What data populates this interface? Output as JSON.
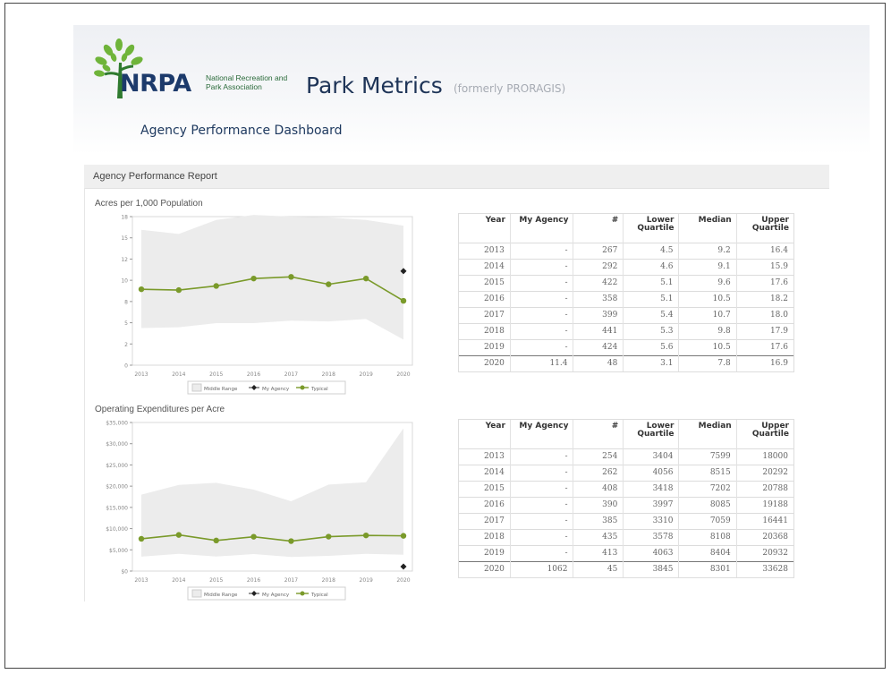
{
  "header": {
    "logo_text": "NRPA",
    "logo_sub": "National Recreation and Park Association",
    "app_title": "Park Metrics",
    "app_subtitle": "(formerly PRORAGIS)",
    "dashboard_title": "Agency Performance Dashboard"
  },
  "report": {
    "title": "Agency Performance Report"
  },
  "legend": {
    "middle_range": "Middle Range",
    "my_agency": "My Agency",
    "typical": "Typical"
  },
  "table_headers": [
    "Year",
    "My Agency",
    "#",
    "Lower Quartile",
    "Median",
    "Upper Quartile"
  ],
  "colors": {
    "series_green": "#7a9a2a",
    "band_gray": "#ececec",
    "agency_marker": "#222222"
  },
  "charts": [
    {
      "title": "Acres per 1,000 Population",
      "chart_data": {
        "type": "line",
        "x": [
          "2013",
          "2014",
          "2015",
          "2016",
          "2017",
          "2018",
          "2019",
          "2020"
        ],
        "ylim": [
          0,
          18
        ],
        "y_ticks": [
          "0",
          "2",
          "5",
          "8",
          "10",
          "12",
          "15",
          "18"
        ],
        "series": [
          {
            "name": "Typical",
            "values": [
              9.2,
              9.1,
              9.6,
              10.5,
              10.7,
              9.8,
              10.5,
              7.8
            ]
          },
          {
            "name": "My Agency",
            "values": [
              null,
              null,
              null,
              null,
              null,
              null,
              null,
              11.4
            ]
          }
        ],
        "band": {
          "name": "Middle Range",
          "lower": [
            4.5,
            4.6,
            5.1,
            5.1,
            5.4,
            5.3,
            5.6,
            3.1
          ],
          "upper": [
            16.4,
            15.9,
            17.6,
            18.2,
            18.0,
            17.9,
            17.6,
            16.9
          ]
        }
      },
      "table": [
        [
          "2013",
          "-",
          "267",
          "4.5",
          "9.2",
          "16.4"
        ],
        [
          "2014",
          "-",
          "292",
          "4.6",
          "9.1",
          "15.9"
        ],
        [
          "2015",
          "-",
          "422",
          "5.1",
          "9.6",
          "17.6"
        ],
        [
          "2016",
          "-",
          "358",
          "5.1",
          "10.5",
          "18.2"
        ],
        [
          "2017",
          "-",
          "399",
          "5.4",
          "10.7",
          "18.0"
        ],
        [
          "2018",
          "-",
          "441",
          "5.3",
          "9.8",
          "17.9"
        ],
        [
          "2019",
          "-",
          "424",
          "5.6",
          "10.5",
          "17.6"
        ],
        [
          "2020",
          "11.4",
          "48",
          "3.1",
          "7.8",
          "16.9"
        ]
      ]
    },
    {
      "title": "Operating Expenditures per Acre",
      "chart_data": {
        "type": "line",
        "x": [
          "2013",
          "2014",
          "2015",
          "2016",
          "2017",
          "2018",
          "2019",
          "2020"
        ],
        "ylim": [
          0,
          35000
        ],
        "y_ticks": [
          "$0",
          "$5,000",
          "$10,000",
          "$15,000",
          "$20,000",
          "$25,000",
          "$30,000",
          "$35,000"
        ],
        "series": [
          {
            "name": "Typical",
            "values": [
              7599,
              8515,
              7202,
              8085,
              7059,
              8108,
              8404,
              8301
            ]
          },
          {
            "name": "My Agency",
            "values": [
              null,
              null,
              null,
              null,
              null,
              null,
              null,
              1062
            ]
          }
        ],
        "band": {
          "name": "Middle Range",
          "lower": [
            3404,
            4056,
            3418,
            3997,
            3310,
            3578,
            4063,
            3845
          ],
          "upper": [
            18000,
            20292,
            20788,
            19188,
            16441,
            20368,
            20932,
            33628
          ]
        }
      },
      "table": [
        [
          "2013",
          "-",
          "254",
          "3404",
          "7599",
          "18000"
        ],
        [
          "2014",
          "-",
          "262",
          "4056",
          "8515",
          "20292"
        ],
        [
          "2015",
          "-",
          "408",
          "3418",
          "7202",
          "20788"
        ],
        [
          "2016",
          "-",
          "390",
          "3997",
          "8085",
          "19188"
        ],
        [
          "2017",
          "-",
          "385",
          "3310",
          "7059",
          "16441"
        ],
        [
          "2018",
          "-",
          "435",
          "3578",
          "8108",
          "20368"
        ],
        [
          "2019",
          "-",
          "413",
          "4063",
          "8404",
          "20932"
        ],
        [
          "2020",
          "1062",
          "45",
          "3845",
          "8301",
          "33628"
        ]
      ]
    }
  ]
}
